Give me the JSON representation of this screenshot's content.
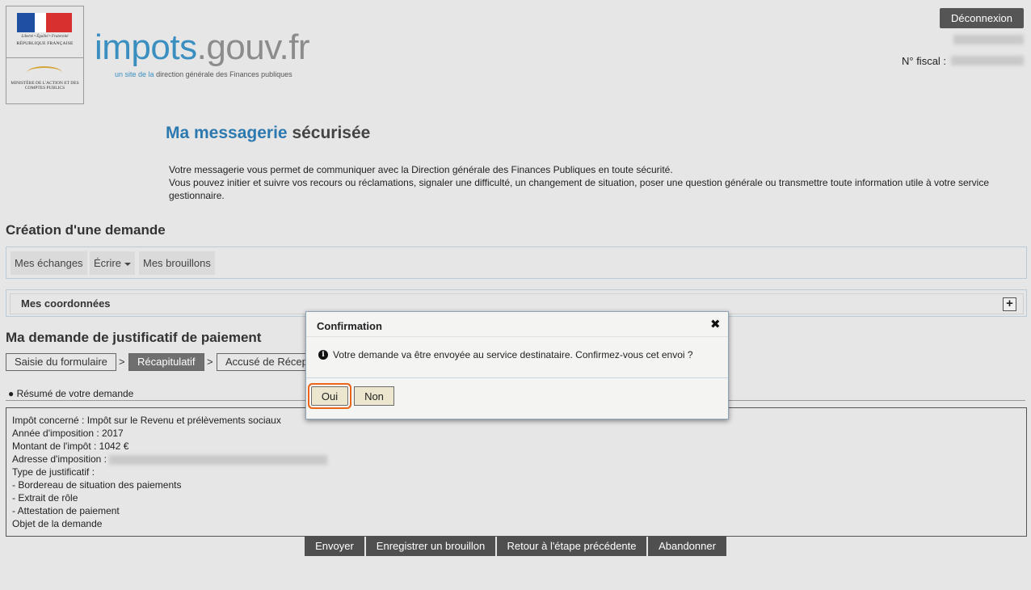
{
  "header": {
    "motto": "Liberté • Égalité • Fraternité",
    "republique": "RÉPUBLIQUE FRANÇAISE",
    "ministere": "MINISTÈRE DE L'ACTION ET DES COMPTES PUBLICS",
    "brand_a": "impots",
    "brand_b": ".gouv.fr",
    "brand_sub_a": "un site de la",
    "brand_sub_b": "direction générale des Finances publiques",
    "logout": "Déconnexion",
    "fiscal_label": "N° fiscal :"
  },
  "page": {
    "title_a": "Ma messagerie",
    "title_b": "sécurisée",
    "intro_1": "Votre messagerie vous permet de communiquer avec la Direction générale des Finances Publiques en toute sécurité.",
    "intro_2": "Vous pouvez initier et suivre vos recours ou réclamations, signaler une difficulté, un changement de situation, poser une question générale ou transmettre toute information utile à votre service gestionnaire."
  },
  "creation": {
    "heading": "Création d'une demande",
    "nav": [
      "Mes échanges",
      "Écrire",
      "Mes brouillons"
    ]
  },
  "coordonnees": {
    "title": "Mes coordonnées"
  },
  "demande": {
    "heading": "Ma demande de justificatif de paiement",
    "steps": [
      "Saisie du formulaire",
      "Récapitulatif",
      "Accusé de Réception"
    ],
    "resume_label": "Résumé de votre demande",
    "lines": [
      "Impôt concerné : Impôt sur le Revenu et prélèvements sociaux",
      "Année d'imposition : 2017",
      "Montant de l'impôt : 1042  €",
      "Adresse d'imposition :",
      "Type de justificatif :",
      "- Bordereau de situation des paiements",
      "- Extrait de rôle",
      "- Attestation de paiement",
      "Objet de la demande"
    ],
    "actions": [
      "Envoyer",
      "Enregistrer un brouillon",
      "Retour à l'étape précédente",
      "Abandonner"
    ]
  },
  "modal": {
    "title": "Confirmation",
    "close": "✖",
    "message": "Votre demande va être envoyée au service destinataire. Confirmez-vous cet envoi ?",
    "yes": "Oui",
    "no": "Non"
  },
  "colors": {
    "brand_blue": "#3b8fc0",
    "focus_orange": "#e8651a",
    "button_dark": "#4f4f4f"
  }
}
